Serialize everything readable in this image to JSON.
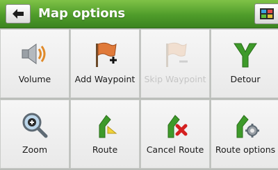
{
  "header": {
    "title": "Map options",
    "back_icon": "arrow-left-icon",
    "map_icon": "map-view-icon"
  },
  "tiles": [
    {
      "label": "Volume",
      "icon": "speaker-volume-icon",
      "enabled": true
    },
    {
      "label": "Add Waypoint",
      "icon": "flag-add-icon",
      "enabled": true
    },
    {
      "label": "Skip Waypoint",
      "icon": "flag-remove-icon",
      "enabled": false
    },
    {
      "label": "Detour",
      "icon": "detour-icon",
      "enabled": true
    },
    {
      "label": "Zoom",
      "icon": "magnifier-zoom-icon",
      "enabled": true
    },
    {
      "label": "Route",
      "icon": "route-icon",
      "enabled": true
    },
    {
      "label": "Cancel Route",
      "icon": "route-cancel-icon",
      "enabled": true
    },
    {
      "label": "Route options",
      "icon": "route-settings-icon",
      "enabled": true
    }
  ],
  "colors": {
    "header_green": "#4f9c2a",
    "route_green": "#2f8a1c",
    "flag_orange": "#e07a3a",
    "cancel_red": "#d42020"
  }
}
